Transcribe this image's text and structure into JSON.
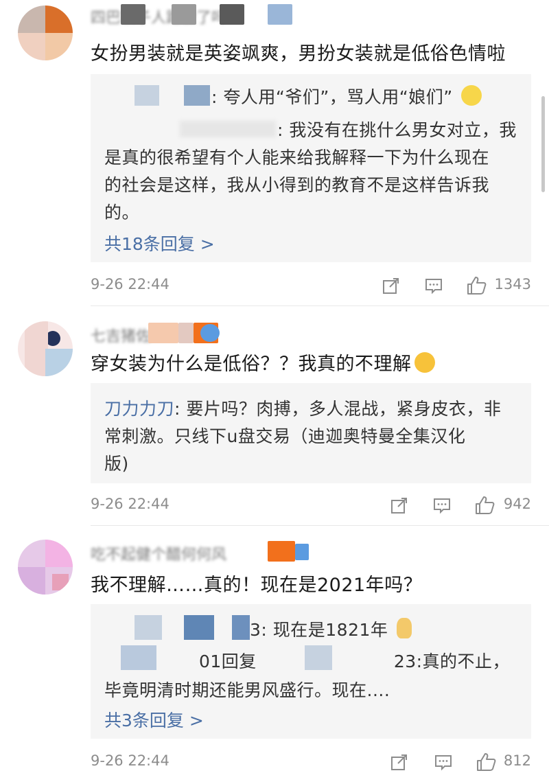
{
  "comments": [
    {
      "username": "四巴被子人路脸了吗",
      "text": "女扮男装就是英姿飒爽，男扮女装就是低俗色情啦",
      "replies": [
        {
          "name": "",
          "text": ": 夸人用“爷们”，骂人用“娘们”"
        },
        {
          "name": "",
          "text_lines": [
            ": 我没有在挑什么男女对立，我",
            "是真的很希望有个人能来给我解释一下为什么现在",
            "的社会是这样，我从小得到的教育不是这样告诉我",
            "的。"
          ]
        }
      ],
      "more_replies": "共18条回复 >",
      "time": "9-26 22:44",
      "likes": "1343"
    },
    {
      "username": "七吉猪佐",
      "text": "穿女装为什么是低俗？？我真的不理解",
      "replies": [
        {
          "name": "刀力力刀",
          "text_lines": [
            ": 要片吗？肉搏，多人混战，紧身皮衣，非",
            "常刺激。只线下u盘交易（迪迦奥特曼全集汉化",
            "版)"
          ]
        }
      ],
      "time": "9-26 22:44",
      "likes": "942"
    },
    {
      "username": "吃不起健个醋何何风",
      "text": "我不理解……真的！现在是2021年吗？",
      "replies": [
        {
          "name": "",
          "text": "3: 现在是1821年"
        },
        {
          "name": "",
          "text_lines": [
            "01回复",
            "23:真的不止，",
            "毕竟明清时期还能男风盛行。现在...."
          ]
        }
      ],
      "more_replies": "共3条回复 >",
      "time": "9-26 22:44",
      "likes": "812"
    }
  ],
  "icons": {
    "repost": "repost-icon",
    "comment": "comment-icon",
    "like": "like-icon"
  },
  "colors": {
    "link": "#4a6fa5",
    "reply_bg": "#f5f5f5",
    "meta": "#8c8c8c"
  }
}
